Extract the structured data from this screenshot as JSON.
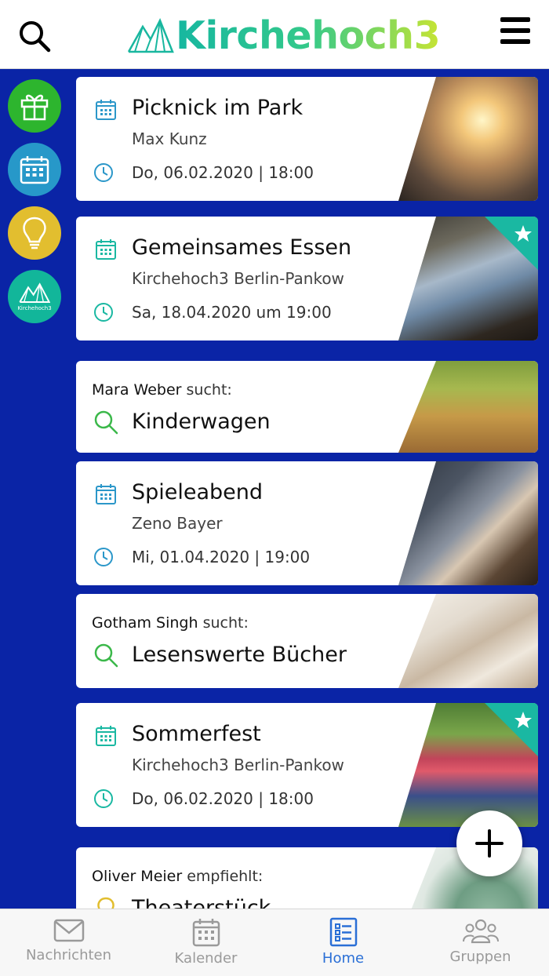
{
  "header": {
    "app_name": "Kirchehoch3"
  },
  "sidebar": {
    "logo_caption": "Kirchehoch3"
  },
  "cards": {
    "picknick": {
      "title": "Picknick im Park",
      "organizer": "Max Kunz",
      "datetime": "Do, 06.02.2020 | 18:00"
    },
    "essen": {
      "title": "Gemeinsames Essen",
      "organizer": "Kirchehoch3 Berlin-Pankow",
      "datetime": "Sa, 18.04.2020 um 19:00",
      "starred": true
    },
    "kinderwagen": {
      "person": "Mara Weber",
      "verb": "sucht:",
      "item": "Kinderwagen"
    },
    "spieleabend": {
      "title": "Spieleabend",
      "organizer": "Zeno Bayer",
      "datetime": "Mi, 01.04.2020 | 19:00"
    },
    "buecher": {
      "person": "Gotham Singh",
      "verb": "sucht:",
      "item": "Lesenswerte Bücher"
    },
    "sommerfest": {
      "title": "Sommerfest",
      "organizer": "Kirchehoch3 Berlin-Pankow",
      "datetime": "Do, 06.02.2020 | 18:00",
      "starred": true
    },
    "theater": {
      "person": "Oliver Meier",
      "verb": "empfiehlt:",
      "item": "Theaterstück"
    }
  },
  "tabs": {
    "nachrichten": "Nachrichten",
    "kalender": "Kalender",
    "home": "Home",
    "gruppen": "Gruppen"
  },
  "colors": {
    "background": "#0a24a6",
    "accent_teal": "#1ab8a2",
    "tab_active": "#2a6fd6",
    "gift": "#2db52e",
    "calendar": "#2798c9",
    "idea": "#e2be2f"
  }
}
